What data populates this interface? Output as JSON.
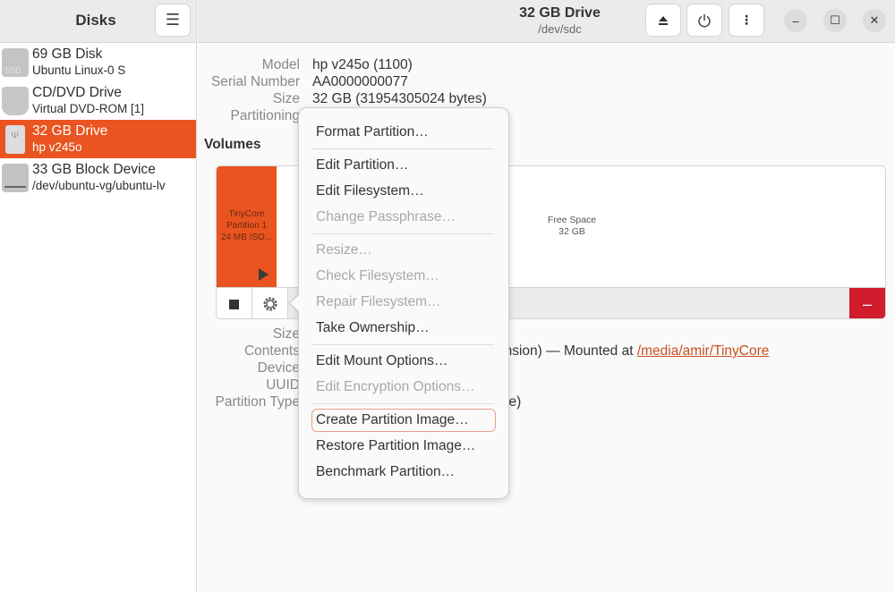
{
  "sidebar": {
    "title": "Disks",
    "menu_icon": "hamburger-menu-icon",
    "disks": [
      {
        "name": "69 GB Disk",
        "subtitle": "Ubuntu Linux-0 S",
        "icon": "ssd-icon",
        "selected": false
      },
      {
        "name": "CD/DVD Drive",
        "subtitle": "Virtual DVD-ROM [1]",
        "icon": "optical-drive-icon",
        "selected": false
      },
      {
        "name": "32 GB Drive",
        "subtitle": "hp v245o",
        "icon": "usb-drive-icon",
        "selected": true
      },
      {
        "name": "33 GB Block Device",
        "subtitle": "/dev/ubuntu-vg/ubuntu-lv",
        "icon": "block-device-icon",
        "selected": false
      }
    ]
  },
  "header": {
    "title": "32 GB Drive",
    "subtitle": "/dev/sdc",
    "buttons": {
      "eject": "eject-icon",
      "power": "power-icon",
      "more": "more-vertical-icon"
    },
    "window": {
      "minimize": "–",
      "maximize": "☐",
      "close": "✕"
    }
  },
  "drive_info": {
    "model_label": "Model",
    "model_value": "hp v245o (1100)",
    "serial_label": "Serial Number",
    "serial_value": "AA0000000077",
    "size_label": "Size",
    "size_value": "32 GB (31954305024 bytes)",
    "partitioning_label": "Partitioning"
  },
  "volumes": {
    "heading": "Volumes",
    "partition": {
      "line1": "TinyCore",
      "line2": "Partition 1",
      "line3": "24 MB ISO..."
    },
    "free_space": {
      "line1": "Free Space",
      "line2": "32 GB"
    },
    "accent_color": "#e95420",
    "delete_color": "#d01c2c",
    "delete_label": "–"
  },
  "partition_info": {
    "size_label": "Size",
    "contents_label": "Contents",
    "contents_value_visible": "ension) — Mounted at",
    "mount_link": "/media/amir/TinyCore",
    "device_label": "Device",
    "uuid_label": "UUID",
    "type_label": "Partition Type",
    "type_value_visible": "le)"
  },
  "popover_menu": {
    "items": [
      {
        "label": "Format Partition…",
        "enabled": true
      },
      {
        "label": "Edit Partition…",
        "enabled": true
      },
      {
        "label": "Edit Filesystem…",
        "enabled": true
      },
      {
        "label": "Change Passphrase…",
        "enabled": false
      },
      {
        "label": "Resize…",
        "enabled": false
      },
      {
        "label": "Check Filesystem…",
        "enabled": false
      },
      {
        "label": "Repair Filesystem…",
        "enabled": false
      },
      {
        "label": "Take Ownership…",
        "enabled": true
      },
      {
        "label": "Edit Mount Options…",
        "enabled": true
      },
      {
        "label": "Edit Encryption Options…",
        "enabled": false
      },
      {
        "label": "Create Partition Image…",
        "enabled": true,
        "focused": true
      },
      {
        "label": "Restore Partition Image…",
        "enabled": true
      },
      {
        "label": "Benchmark Partition…",
        "enabled": true
      }
    ]
  }
}
